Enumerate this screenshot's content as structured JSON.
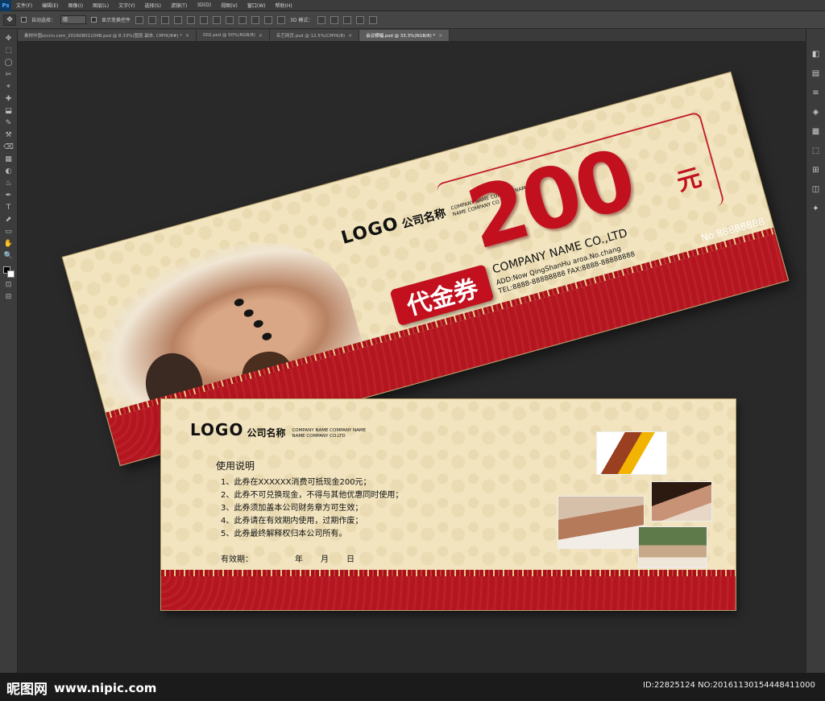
{
  "app": {
    "logo_text": "Ps"
  },
  "menu": [
    "文件(F)",
    "编辑(E)",
    "图像(I)",
    "图层(L)",
    "文字(Y)",
    "选择(S)",
    "滤镜(T)",
    "3D(D)",
    "视图(V)",
    "窗口(W)",
    "帮助(H)"
  ],
  "options": {
    "auto_select_label": "自动选择：",
    "auto_select_value": "组",
    "show_transform_label": "显示变换控件",
    "mode_3d_label": "3D 模式："
  },
  "tabs": [
    {
      "label": "素材中国sccnn.com_20160801104B.psd @ 8.33%(图层 副本, CMYK/8#) *",
      "active": false
    },
    {
      "label": "002.psd @ 50%(RGB/8)",
      "active": false
    },
    {
      "label": "名艺网页.psd @ 12.5%(CMYK/8)",
      "active": false
    },
    {
      "label": "会议横幅.psd @ 33.3%(RGB/8) *",
      "active": true
    }
  ],
  "toolbox": [
    "✥",
    "⬚",
    "◯",
    "✂",
    "⌖",
    "✚",
    "⬓",
    "✎",
    "⚒",
    "⌫",
    "▦",
    "◐",
    "♨",
    "✒",
    "T",
    "⬈",
    "▭",
    "✋",
    "🔍",
    "⊡",
    "⊟"
  ],
  "right_panel": [
    "◧",
    "▤",
    "≡",
    "◈",
    "▦",
    "⬚",
    "⊞",
    "◫",
    "✦"
  ],
  "front": {
    "logo": "LOGO",
    "company_cn": "公司名称",
    "company_sub_1": "COMPANY NAME COMPANY NAME",
    "company_sub_2": "NAME COMPANY CO.LTD",
    "amount": "200",
    "currency": "元",
    "badge": "代金券",
    "company_en": "COMPANY NAME CO.,LTD",
    "address": "ADD:Now QingShanHu aroa.No.chang",
    "tel_fax": "TEL:8888-88888888  FAX:8888-88888888",
    "serial": "No.88888888"
  },
  "back": {
    "logo": "LOGO",
    "company_cn": "公司名称",
    "company_sub_1": "COMPANY NAME COMPANY NAME",
    "company_sub_2": "NAME COMPANY CO.LTD",
    "usage_title": "使用说明",
    "rules": [
      "1、此券在XXXXXX消费可抵现金200元；",
      "2、此券不可兑换现金，不得与其他优惠同时使用；",
      "3、此券须加盖本公司财务章方可生效；",
      "4、此券请在有效期内使用，过期作废；",
      "5、此券最终解释权归本公司所有。"
    ],
    "validity_label": "有效期：",
    "year": "年",
    "month": "月",
    "day": "日"
  },
  "watermark": {
    "site_cn": "昵图网",
    "site_url": "www.nipic.com",
    "id_text": "ID:22825124 NO:20161130154448411000"
  },
  "colors": {
    "accent_red": "#c2101f",
    "paper": "#f1e4bf",
    "ps_bg": "#2b2b2b"
  }
}
